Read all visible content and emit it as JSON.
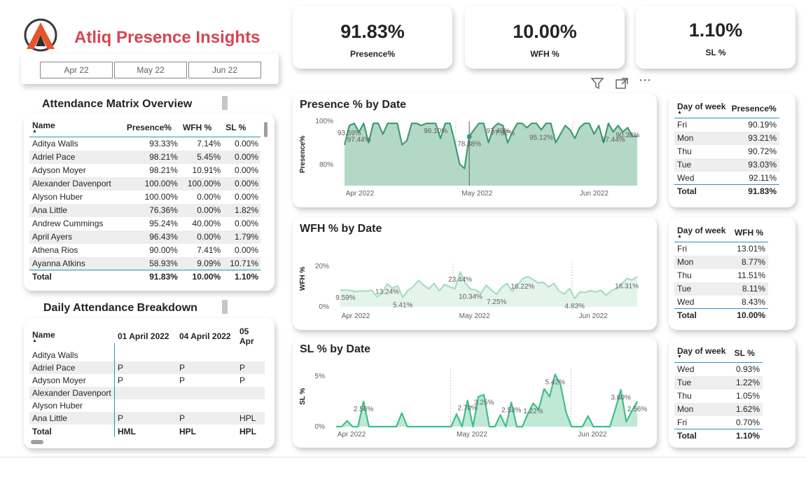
{
  "brand": {
    "title": "Atliq Presence Insights",
    "logo_color": "#e8542c"
  },
  "month_slicer": [
    "Apr 22",
    "May 22",
    "Jun 22"
  ],
  "kpis": [
    {
      "value": "91.83%",
      "label": "Presence%"
    },
    {
      "value": "10.00%",
      "label": "WFH %"
    },
    {
      "value": "1.10%",
      "label": "SL %"
    }
  ],
  "toolbar": {
    "filter_icon": "filter-icon",
    "focus_icon": "focus-mode-icon",
    "more_icon": "more-options-icon",
    "more_label": "⋯"
  },
  "attendance_matrix": {
    "title": "Attendance Matrix Overview",
    "headers": [
      "Name",
      "Presence%",
      "WFH %",
      "SL %"
    ],
    "rows": [
      [
        "Aditya Walls",
        "93.33%",
        "7.14%",
        "0.00%"
      ],
      [
        "Adriel Pace",
        "98.21%",
        "5.45%",
        "0.00%"
      ],
      [
        "Adyson Moyer",
        "98.21%",
        "10.91%",
        "0.00%"
      ],
      [
        "Alexander Davenport",
        "100.00%",
        "100.00%",
        "0.00%"
      ],
      [
        "Alyson Huber",
        "100.00%",
        "0.00%",
        "0.00%"
      ],
      [
        "Ana Little",
        "76.36%",
        "0.00%",
        "1.82%"
      ],
      [
        "Andrew Cummings",
        "95.24%",
        "40.00%",
        "0.00%"
      ],
      [
        "April Ayers",
        "96.43%",
        "0.00%",
        "1.79%"
      ],
      [
        "Athena Rios",
        "90.00%",
        "7.41%",
        "0.00%"
      ],
      [
        "Ayanna Atkins",
        "58.93%",
        "9.09%",
        "10.71%"
      ]
    ],
    "total": [
      "Total",
      "91.83%",
      "10.00%",
      "1.10%"
    ]
  },
  "daily_breakdown": {
    "title": "Daily Attendance Breakdown",
    "headers": [
      "Name",
      "01 April 2022",
      "04 April 2022",
      "05 Apr"
    ],
    "rows": [
      [
        "Aditya Walls",
        "",
        "",
        ""
      ],
      [
        "Adriel Pace",
        "P",
        "P",
        "P"
      ],
      [
        "Adyson Moyer",
        "P",
        "P",
        "P"
      ],
      [
        "Alexander Davenport",
        "",
        "",
        ""
      ],
      [
        "Alyson Huber",
        "",
        "",
        ""
      ],
      [
        "Ana Little",
        "P",
        "P",
        "HPL"
      ]
    ],
    "total": [
      "Total",
      "HML",
      "HPL",
      "HPL"
    ]
  },
  "chart_data": [
    {
      "type": "area",
      "title": "Presence % by Date",
      "ylabel": "Presence%",
      "y_ticks": [
        "100%",
        "80%"
      ],
      "ylim": [
        70,
        100
      ],
      "x_ticks": [
        "Apr 2022",
        "May 2022",
        "Jun 2022"
      ],
      "color": "#3f9b73",
      "fill": "#b3d9c6",
      "values": [
        89,
        98,
        99,
        95,
        99,
        90,
        99,
        99,
        94,
        99,
        99,
        99,
        89,
        91,
        99,
        99,
        98,
        99,
        99,
        99,
        92,
        99,
        99,
        90,
        80,
        78,
        93,
        96,
        99,
        99,
        90,
        97,
        99,
        98,
        90,
        95,
        99,
        99,
        97,
        99,
        99,
        96,
        99,
        99,
        90,
        94,
        98,
        96,
        92,
        97,
        99,
        99,
        94,
        98,
        90,
        99,
        95,
        98,
        95,
        97,
        93,
        93
      ],
      "labels": [
        {
          "i": 1,
          "text": "93.59%"
        },
        {
          "i": 3,
          "text": "97.44%"
        },
        {
          "i": 19,
          "text": "96.10%"
        },
        {
          "i": 26,
          "text": "78.38%"
        },
        {
          "i": 32,
          "text": "97.40%"
        },
        {
          "i": 33,
          "text": "77.92%"
        },
        {
          "i": 41,
          "text": "95.12%"
        },
        {
          "i": 56,
          "text": "97.44%"
        },
        {
          "i": 59,
          "text": "90.38%"
        }
      ]
    },
    {
      "type": "area",
      "title": "WFH % by Date",
      "ylabel": "WFH %",
      "y_ticks": [
        "20%",
        "0%"
      ],
      "ylim": [
        0,
        25
      ],
      "x_ticks": [
        "Apr 2022",
        "May 2022",
        "Jun 2022"
      ],
      "color": "#a8dcc4",
      "fill": "#e4f4ec",
      "values": [
        9.6,
        9.6,
        9.4,
        8.8,
        9.2,
        9,
        9.6,
        5.8,
        7.7,
        13.2,
        10.8,
        12.1,
        5.4,
        9.5,
        11.6,
        15.2,
        12.5,
        10.4,
        13.5,
        9.2,
        12.9,
        11.5,
        10.4,
        20.1,
        13.6,
        10.3,
        9.7,
        7.8,
        12.4,
        9.7,
        7.2,
        11.3,
        13.5,
        8.9,
        12.4,
        16.2,
        17.4,
        15.7,
        13.8,
        14.1,
        11.4,
        13.5,
        9.1,
        7.4,
        10.5,
        4.8,
        8.7,
        8.2,
        9.4,
        8.5,
        9.6,
        6.7,
        9.2,
        10.5,
        13.1,
        16.3,
        15.4,
        17.5
      ],
      "labels": [
        {
          "i": 1,
          "text": "9.59%"
        },
        {
          "i": 9,
          "text": "13.24%"
        },
        {
          "i": 12,
          "text": "5.41%"
        },
        {
          "i": 23,
          "text": "23.44%"
        },
        {
          "i": 25,
          "text": "10.34%"
        },
        {
          "i": 30,
          "text": "7.25%"
        },
        {
          "i": 35,
          "text": "16.22%"
        },
        {
          "i": 45,
          "text": "4.83%"
        },
        {
          "i": 55,
          "text": "16.31%"
        }
      ]
    },
    {
      "type": "area",
      "title": "SL % by Date",
      "ylabel": "SL %",
      "y_ticks": [
        "5%",
        "0%"
      ],
      "ylim": [
        0,
        6
      ],
      "x_ticks": [
        "Apr 2022",
        "May 2022",
        "Jun 2022"
      ],
      "color": "#3fbf8a",
      "fill": "#bfe9d4",
      "values": [
        0,
        0,
        0.6,
        0,
        0,
        2.6,
        0,
        0,
        0,
        0,
        0,
        0,
        1.4,
        0,
        0,
        0,
        0,
        0,
        0,
        0,
        0,
        0,
        1.3,
        0,
        2.7,
        0,
        3.1,
        3.3,
        0,
        0,
        1.2,
        0,
        2.5,
        0,
        0,
        1.3,
        2.4,
        1.8,
        3.9,
        3.1,
        5.4,
        4.3,
        1.5,
        0,
        0,
        0,
        1.1,
        0,
        0,
        0,
        0,
        1.8,
        3.8,
        0.5,
        1.6,
        2.6
      ],
      "labels": [
        {
          "i": 5,
          "text": "2.56%"
        },
        {
          "i": 24,
          "text": "2.70%"
        },
        {
          "i": 27,
          "text": "3.25%"
        },
        {
          "i": 32,
          "text": "2.53%"
        },
        {
          "i": 36,
          "text": "1.22%"
        },
        {
          "i": 40,
          "text": "5.42%"
        },
        {
          "i": 52,
          "text": "3.80%"
        },
        {
          "i": 55,
          "text": "2.56%"
        }
      ]
    }
  ],
  "dow_tables": [
    {
      "headers": [
        "Day of week",
        "Presence%"
      ],
      "rows": [
        [
          "Fri",
          "90.19%"
        ],
        [
          "Mon",
          "93.21%"
        ],
        [
          "Thu",
          "90.72%"
        ],
        [
          "Tue",
          "93.03%"
        ],
        [
          "Wed",
          "92.11%"
        ]
      ],
      "total": [
        "Total",
        "91.83%"
      ]
    },
    {
      "headers": [
        "Day of week",
        "WFH %"
      ],
      "rows": [
        [
          "Fri",
          "13.01%"
        ],
        [
          "Mon",
          "8.77%"
        ],
        [
          "Thu",
          "11.51%"
        ],
        [
          "Tue",
          "8.11%"
        ],
        [
          "Wed",
          "8.43%"
        ]
      ],
      "total": [
        "Total",
        "10.00%"
      ]
    },
    {
      "headers": [
        "Day of week",
        "SL %"
      ],
      "rows": [
        [
          "Wed",
          "0.93%"
        ],
        [
          "Tue",
          "1.22%"
        ],
        [
          "Thu",
          "1.05%"
        ],
        [
          "Mon",
          "1.62%"
        ],
        [
          "Fri",
          "0.70%"
        ]
      ],
      "total": [
        "Total",
        "1.10%"
      ]
    }
  ]
}
